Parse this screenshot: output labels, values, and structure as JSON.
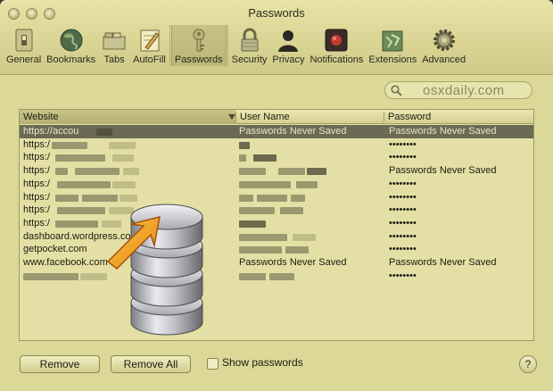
{
  "window": {
    "title": "Passwords"
  },
  "toolbar": {
    "items": [
      {
        "label": "General",
        "icon": "general-switch-icon"
      },
      {
        "label": "Bookmarks",
        "icon": "globe-icon"
      },
      {
        "label": "Tabs",
        "icon": "tabs-icon"
      },
      {
        "label": "AutoFill",
        "icon": "pencil-note-icon"
      },
      {
        "label": "Passwords",
        "icon": "key-icon",
        "selected": true
      },
      {
        "label": "Security",
        "icon": "padlock-icon"
      },
      {
        "label": "Privacy",
        "icon": "person-silhouette-icon"
      },
      {
        "label": "Notifications",
        "icon": "notification-icon"
      },
      {
        "label": "Extensions",
        "icon": "puzzle-icon"
      },
      {
        "label": "Advanced",
        "icon": "gear-icon"
      }
    ]
  },
  "search": {
    "value": "osxdaily.com",
    "icon": "magnifier-icon"
  },
  "table": {
    "columns": [
      "Website",
      "User Name",
      "Password"
    ],
    "rows": [
      {
        "website": "https://accou",
        "username": "Passwords Never Saved",
        "password": "Passwords Never Saved",
        "selected": true
      },
      {
        "website": "https:/",
        "username": "",
        "password": "••••••••"
      },
      {
        "website": "https:/",
        "username": "",
        "password": "••••••••"
      },
      {
        "website": "https:/",
        "username": "",
        "password": "Passwords Never Saved"
      },
      {
        "website": "https:/",
        "username": "",
        "password": "••••••••"
      },
      {
        "website": "https:/",
        "username": "",
        "password": "••••••••"
      },
      {
        "website": "https:/",
        "username": "",
        "password": "••••••••"
      },
      {
        "website": "https:/",
        "username": "",
        "password": "••••••••"
      },
      {
        "website": "dashboard.wordpress.com",
        "username": "",
        "password": "••••••••"
      },
      {
        "website": "getpocket.com",
        "username": "",
        "password": "••••••••"
      },
      {
        "website": "www.facebook.com",
        "username": "Passwords Never Saved",
        "password": "Passwords Never Saved"
      },
      {
        "website": "",
        "username": "",
        "password": "••••••••"
      }
    ]
  },
  "actions": {
    "remove_label": "Remove",
    "remove_all_label": "Remove All",
    "show_passwords_label": "Show passwords",
    "show_passwords_checked": false,
    "help_label": "?"
  },
  "overlay": {
    "icon": "disk-import-arrow-icon"
  },
  "colors": {
    "window_tint": "#dcd898",
    "selection": "#6b6a54"
  }
}
